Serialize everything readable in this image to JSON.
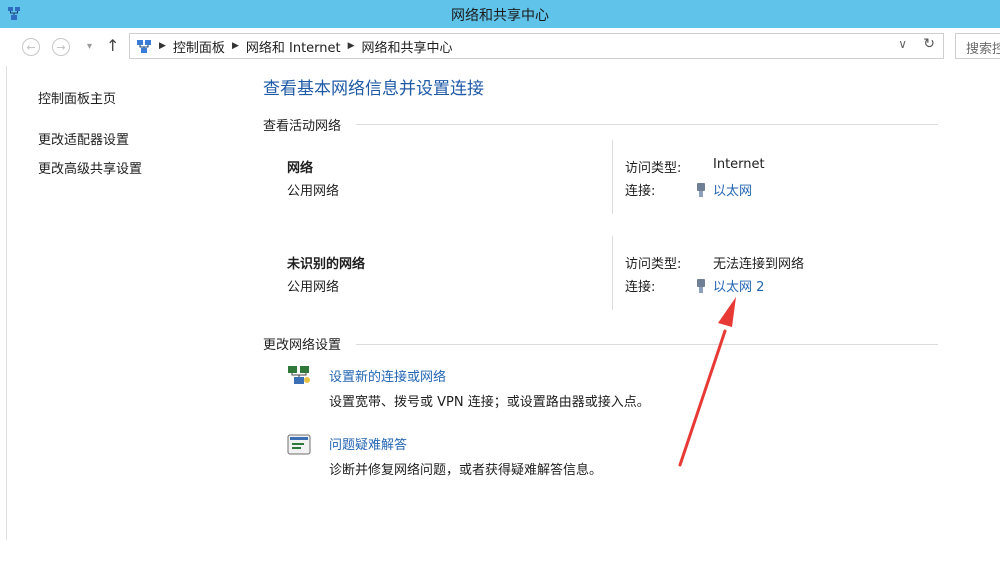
{
  "window": {
    "title": "网络和共享中心"
  },
  "address": {
    "crumbs": [
      "控制面板",
      "网络和 Internet",
      "网络和共享中心"
    ],
    "search_placeholder": "搜索控制面板"
  },
  "sidebar": {
    "home": "控制面板主页",
    "links": [
      "更改适配器设置",
      "更改高级共享设置"
    ]
  },
  "main": {
    "title": "查看基本网络信息并设置连接",
    "active_section": "查看活动网络",
    "networks": [
      {
        "name": "网络",
        "type": "公用网络",
        "access_label": "访问类型:",
        "access_value": "Internet",
        "conn_label": "连接:",
        "conn_value": "以太网"
      },
      {
        "name": "未识别的网络",
        "type": "公用网络",
        "access_label": "访问类型:",
        "access_value": "无法连接到网络",
        "conn_label": "连接:",
        "conn_value": "以太网 2"
      }
    ],
    "change_section": "更改网络设置",
    "tasks": [
      {
        "link": "设置新的连接或网络",
        "desc": "设置宽带、拨号或 VPN 连接；或设置路由器或接入点。"
      },
      {
        "link": "问题疑难解答",
        "desc": "诊断并修复网络问题，或者获得疑难解答信息。"
      }
    ]
  },
  "colors": {
    "titlebar": "#5fc3ea",
    "link": "#2466b3",
    "heading": "#1f5aa6",
    "annotation_arrow": "#e83a35"
  }
}
